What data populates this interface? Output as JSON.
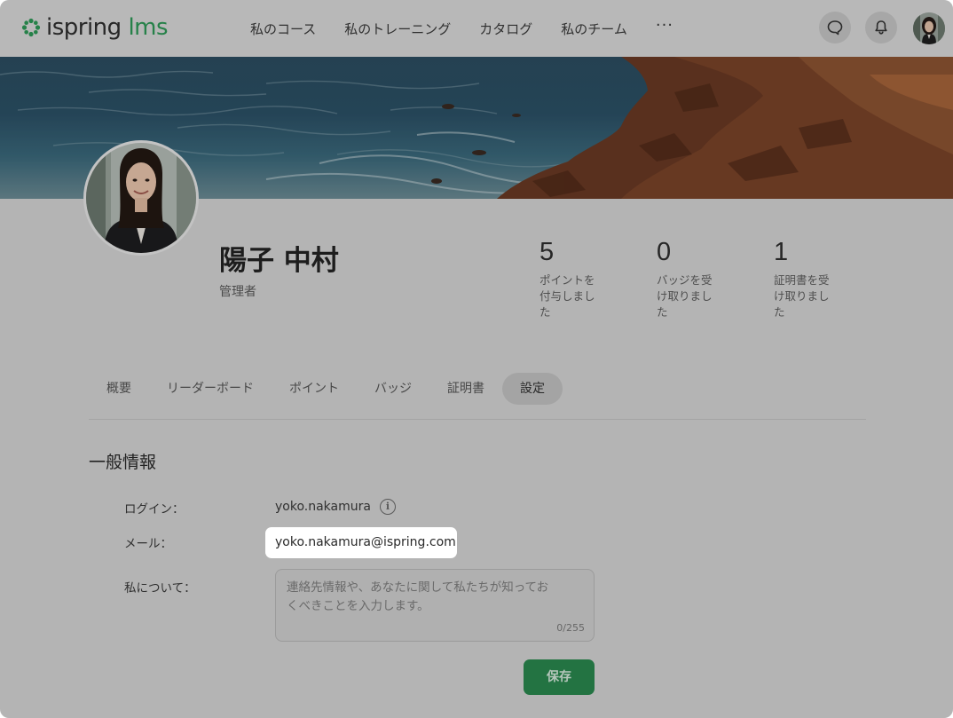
{
  "header": {
    "logo_main": "ispring",
    "logo_accent": "lms",
    "nav": [
      "私のコース",
      "私のトレーニング",
      "カタログ",
      "私のチーム"
    ],
    "more": "···"
  },
  "profile": {
    "name": "陽子 中村",
    "role": "管理者",
    "stats": [
      {
        "value": "5",
        "label": "ポイントを付与しました"
      },
      {
        "value": "0",
        "label": "バッジを受け取りました"
      },
      {
        "value": "1",
        "label": "証明書を受け取りました"
      }
    ]
  },
  "tabs": [
    {
      "label": "概要",
      "active": false
    },
    {
      "label": "リーダーボード",
      "active": false
    },
    {
      "label": "ポイント",
      "active": false
    },
    {
      "label": "バッジ",
      "active": false
    },
    {
      "label": "証明書",
      "active": false
    },
    {
      "label": "設定",
      "active": true
    }
  ],
  "settings": {
    "title": "一般情報",
    "login_label": "ログイン：",
    "login_value": "yoko.nakamura",
    "email_label": "メール：",
    "email_value": "yoko.nakamura@ispring.com",
    "about_label": "私について：",
    "about_placeholder": "連絡先情報や、あなたに関して私たちが知っておくべきことを入力します。",
    "about_counter": "0/255",
    "save_label": "保存"
  },
  "colors": {
    "accent": "#2e9a57",
    "save_button": "#2a8a4f"
  }
}
